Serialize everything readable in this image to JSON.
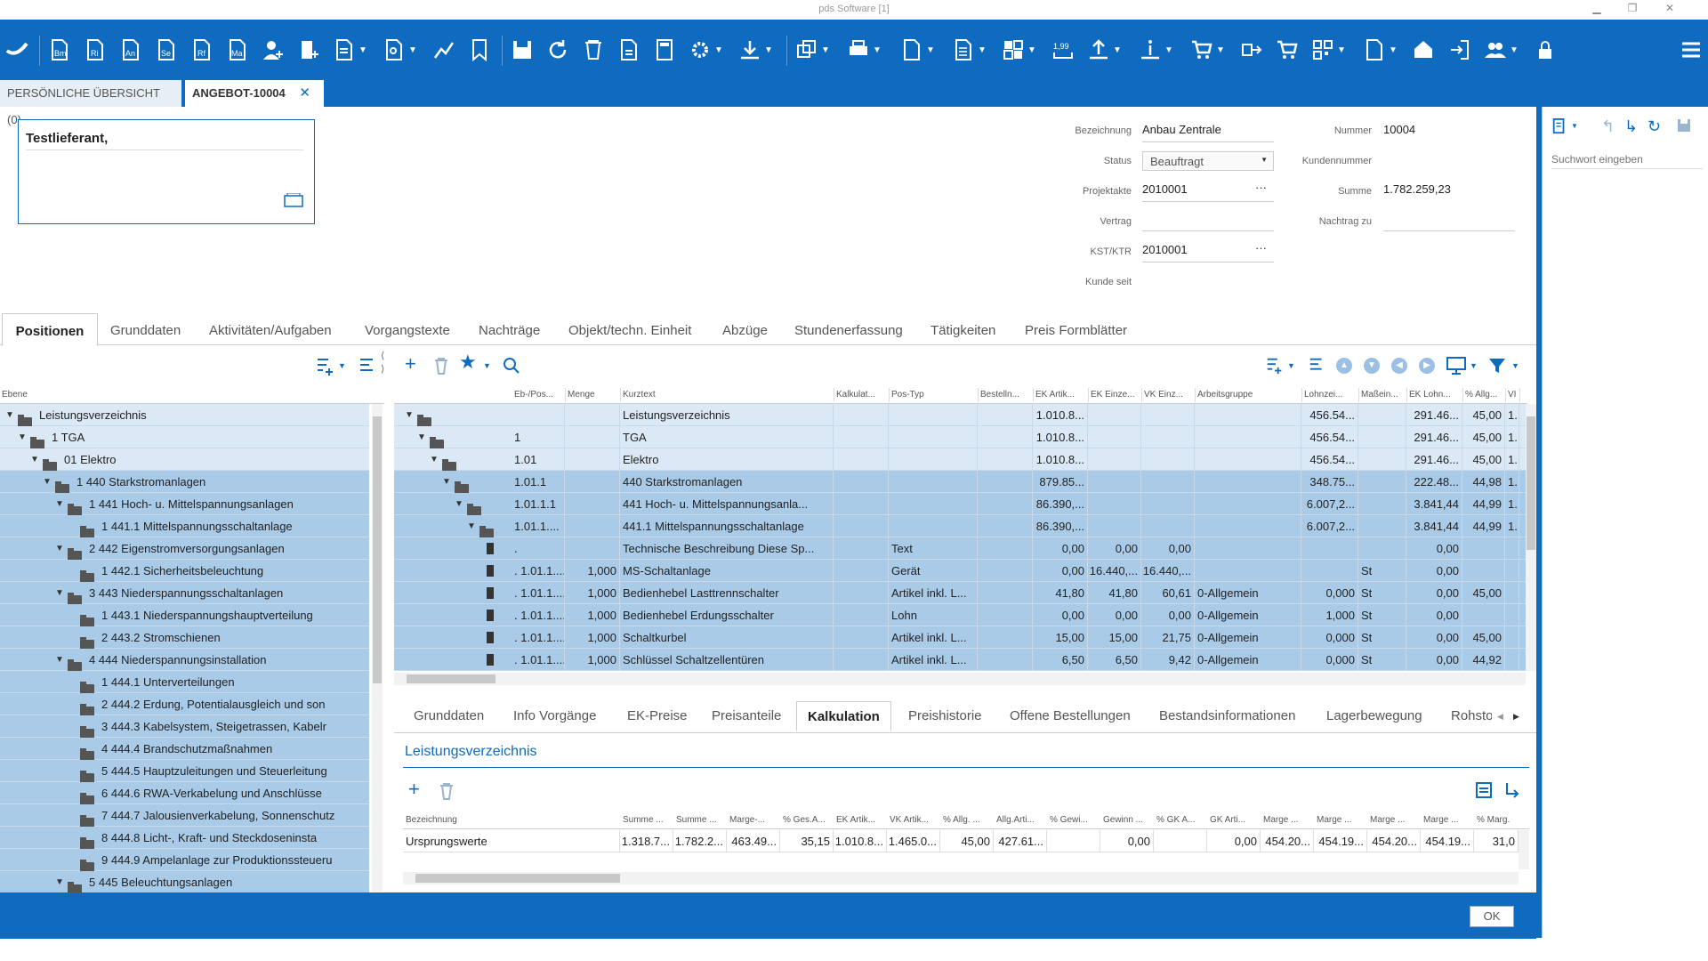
{
  "app": {
    "title": "pds Software [1]"
  },
  "doc_tabs": [
    {
      "label": "PERSÖNLICHE ÜBERSICHT (0)"
    },
    {
      "label": "ANGEBOT-10004"
    }
  ],
  "vendor": {
    "name": "Testlieferant,"
  },
  "header": {
    "bezeichnung_label": "Bezeichnung",
    "bezeichnung": "Anbau Zentrale",
    "status_label": "Status",
    "status": "Beauftragt",
    "projektakte_label": "Projektakte",
    "projektakte": "2010001",
    "vertrag_label": "Vertrag",
    "vertrag": "",
    "kst_label": "KST/KTR",
    "kst": "2010001",
    "kunde_seit_label": "Kunde seit",
    "kunde_seit": "",
    "nummer_label": "Nummer",
    "nummer": "10004",
    "kundennummer_label": "Kundennummer",
    "kundennummer": "",
    "summe_label": "Summe",
    "summe": "1.782.259,23",
    "nachtrag_label": "Nachtrag zu",
    "nachtrag": ""
  },
  "main_tabs": [
    "Positionen",
    "Grunddaten",
    "Aktivitäten/Aufgaben",
    "Vorgangstexte",
    "Nachträge",
    "Objekt/techn. Einheit",
    "Abzüge",
    "Stundenerfassung",
    "Tätigkeiten",
    "Preis Formblätter"
  ],
  "tree": {
    "header": "Ebene",
    "items": [
      {
        "label": "Leistungsverzeichnis"
      },
      {
        "label": "1  TGA"
      },
      {
        "label": "01  Elektro"
      },
      {
        "label": "1  440 Starkstromanlagen"
      },
      {
        "label": "1  441 Hoch- u. Mittelspannungsanlagen"
      },
      {
        "label": "1  441.1 Mittelspannungsschaltanlage"
      },
      {
        "label": "2  442 Eigenstromversorgungsanlagen"
      },
      {
        "label": "1  442.1 Sicherheitsbeleuchtung"
      },
      {
        "label": "3  443 Niederspannungsschaltanlagen"
      },
      {
        "label": "1  443.1 Niederspannungshauptverteilung"
      },
      {
        "label": "2  443.2 Stromschienen"
      },
      {
        "label": "4  444 Niederspannungsinstallation"
      },
      {
        "label": "1  444.1 Unterverteilungen"
      },
      {
        "label": "2  444.2 Erdung, Potentialausgleich und son"
      },
      {
        "label": "3  444.3 Kabelsystem, Steigetrassen, Kabelr"
      },
      {
        "label": "4  444.4 Brandschutzmaßnahmen"
      },
      {
        "label": "5  444.5 Hauptzuleitungen und Steuerleitung"
      },
      {
        "label": "6  444.6 RWA-Verkabelung und Anschlüsse"
      },
      {
        "label": "7  444.7 Jalousienverkabelung, Sonnenschutz"
      },
      {
        "label": "8  444.8 Licht-, Kraft- und Steckdoseninsta"
      },
      {
        "label": "9  444.9 Ampelanlage zur Produktionssteueru"
      },
      {
        "label": "5  445 Beleuchtungsanlagen"
      }
    ]
  },
  "grid": {
    "columns": [
      "Eb-/Pos...",
      "Menge",
      "Kurztext",
      "Kalkulat...",
      "Pos-Typ",
      "Bestelln...",
      "EK Artik...",
      "EK Einze...",
      "VK Einz...",
      "Arbeitsgruppe",
      "Lohnzei...",
      "Maßein...",
      "EK Lohn...",
      "% Allg...",
      "VI"
    ],
    "rows": [
      [
        "",
        "",
        "Leistungsverzeichnis",
        "",
        "",
        "",
        "1.010.8...",
        "",
        "",
        "",
        "456.54...",
        "",
        "291.46...",
        "45,00",
        "1.."
      ],
      [
        "1",
        "",
        "TGA",
        "",
        "",
        "",
        "1.010.8...",
        "",
        "",
        "",
        "456.54...",
        "",
        "291.46...",
        "45,00",
        "1.."
      ],
      [
        "1.01",
        "",
        "Elektro",
        "",
        "",
        "",
        "1.010.8...",
        "",
        "",
        "",
        "456.54...",
        "",
        "291.46...",
        "45,00",
        "1.."
      ],
      [
        "1.01.1",
        "",
        "440 Starkstromanlagen",
        "",
        "",
        "",
        "879.85...",
        "",
        "",
        "",
        "348.75...",
        "",
        "222.48...",
        "44,98",
        "1.."
      ],
      [
        "1.01.1.1",
        "",
        "441 Hoch- u. Mittelspannungsanla...",
        "",
        "",
        "",
        "86.390,...",
        "",
        "",
        "",
        "6.007,2...",
        "",
        "3.841,44",
        "44,99",
        "1.."
      ],
      [
        "1.01.1....",
        "",
        "441.1 Mittelspannungsschaltanlage",
        "",
        "",
        "",
        "86.390,...",
        "",
        "",
        "",
        "6.007,2...",
        "",
        "3.841,44",
        "44,99",
        "1.."
      ],
      [
        ".",
        "",
        "Technische Beschreibung  Diese Sp...",
        "",
        "Text",
        "",
        "0,00",
        "0,00",
        "0,00",
        "",
        "",
        "",
        "0,00",
        "",
        ""
      ],
      [
        ". 1.01.1....",
        "1,000",
        "MS-Schaltanlage",
        "",
        "Gerät",
        "",
        "0,00",
        "16.440,...",
        "16.440,...",
        "",
        "",
        "St",
        "0,00",
        "",
        ""
      ],
      [
        ". 1.01.1....",
        "1,000",
        "Bedienhebel Lasttrennschalter",
        "",
        "Artikel inkl. L...",
        "",
        "41,80",
        "41,80",
        "60,61",
        "0-Allgemein",
        "0,000",
        "St",
        "0,00",
        "45,00",
        ""
      ],
      [
        ". 1.01.1....",
        "1,000",
        "Bedienhebel Erdungsschalter",
        "",
        "Lohn",
        "",
        "0,00",
        "0,00",
        "0,00",
        "0-Allgemein",
        "1,000",
        "St",
        "0,00",
        "",
        ""
      ],
      [
        ". 1.01.1....",
        "1,000",
        "Schaltkurbel",
        "",
        "Artikel inkl. L...",
        "",
        "15,00",
        "15,00",
        "21,75",
        "0-Allgemein",
        "0,000",
        "St",
        "0,00",
        "45,00",
        ""
      ],
      [
        ". 1.01.1....",
        "1,000",
        "Schlüssel Schaltzellentüren",
        "",
        "Artikel inkl. L...",
        "",
        "6,50",
        "6,50",
        "9,42",
        "0-Allgemein",
        "0,000",
        "St",
        "0,00",
        "44,92",
        ""
      ]
    ]
  },
  "sub_tabs": [
    "Grunddaten",
    "Info Vorgänge",
    "EK-Preise",
    "Preisanteile",
    "Kalkulation",
    "Preishistorie",
    "Offene Bestellungen",
    "Bestandsinformationen",
    "Lagerbewegung",
    "Rohsto"
  ],
  "calc": {
    "title": "Leistungsverzeichnis",
    "columns": [
      "Bezeichnung",
      "Summe ...",
      "Summe ...",
      "Marge-...",
      "% Ges.A...",
      "EK Artik...",
      "VK Artik...",
      "% Allg. ...",
      "Allg.Arti...",
      "% Gewi...",
      "Gewinn ...",
      "% GK A...",
      "GK Arti...",
      "Marge ...",
      "Marge ...",
      "Marge ...",
      "Marge ...",
      "% Marg."
    ],
    "row": [
      "Ursprungswerte",
      "1.318.7...",
      "1.782.2...",
      "463.49...",
      "35,15",
      "1.010.8...",
      "1.465.0...",
      "45,00",
      "427.61...",
      "",
      "0,00",
      "",
      "0,00",
      "454.20...",
      "454.19...",
      "454.20...",
      "454.19...",
      "31,0"
    ]
  },
  "right_pane": {
    "search_placeholder": "Suchwort eingeben"
  },
  "ok_label": "OK",
  "colors": {
    "brand": "#0e6bc0",
    "row_selected": "#a9cbe8",
    "row_light": "#dbe8f5"
  }
}
